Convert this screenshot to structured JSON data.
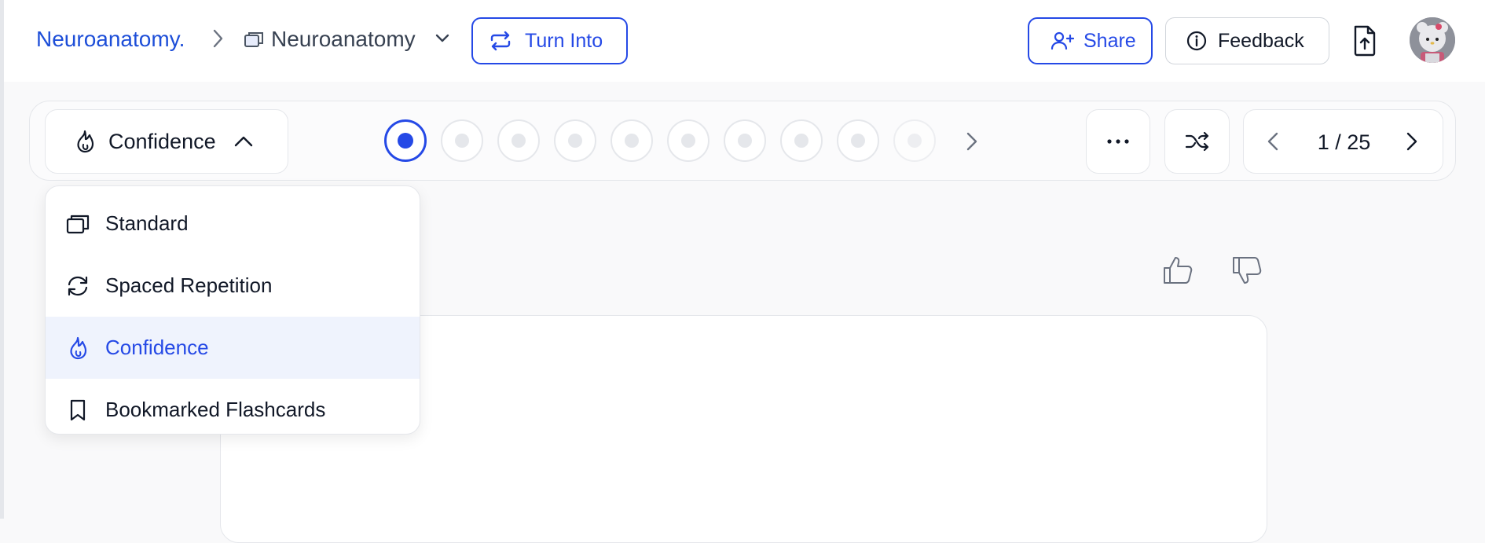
{
  "breadcrumb": {
    "collection": "Neuroanatomy.",
    "deck": "Neuroanatomy"
  },
  "header": {
    "turn_into": "Turn Into",
    "share": "Share",
    "feedback": "Feedback"
  },
  "mode": {
    "selected": "Confidence"
  },
  "progress": {
    "dot_count": 10,
    "active_index": 0
  },
  "pager": {
    "current": 1,
    "total": 25,
    "label": "1 / 25"
  },
  "mode_menu": {
    "items": [
      {
        "label": "Standard",
        "icon": "cards-icon",
        "selected": false
      },
      {
        "label": "Spaced Repetition",
        "icon": "refresh-icon",
        "selected": false
      },
      {
        "label": "Confidence",
        "icon": "flame-icon",
        "selected": true
      },
      {
        "label": "Bookmarked Flashcards",
        "icon": "bookmark-icon",
        "selected": false
      }
    ]
  },
  "colors": {
    "accent": "#2549e6",
    "link": "#1d4ed8",
    "border": "#e5e7eb",
    "selected_bg": "#eff3fd"
  }
}
